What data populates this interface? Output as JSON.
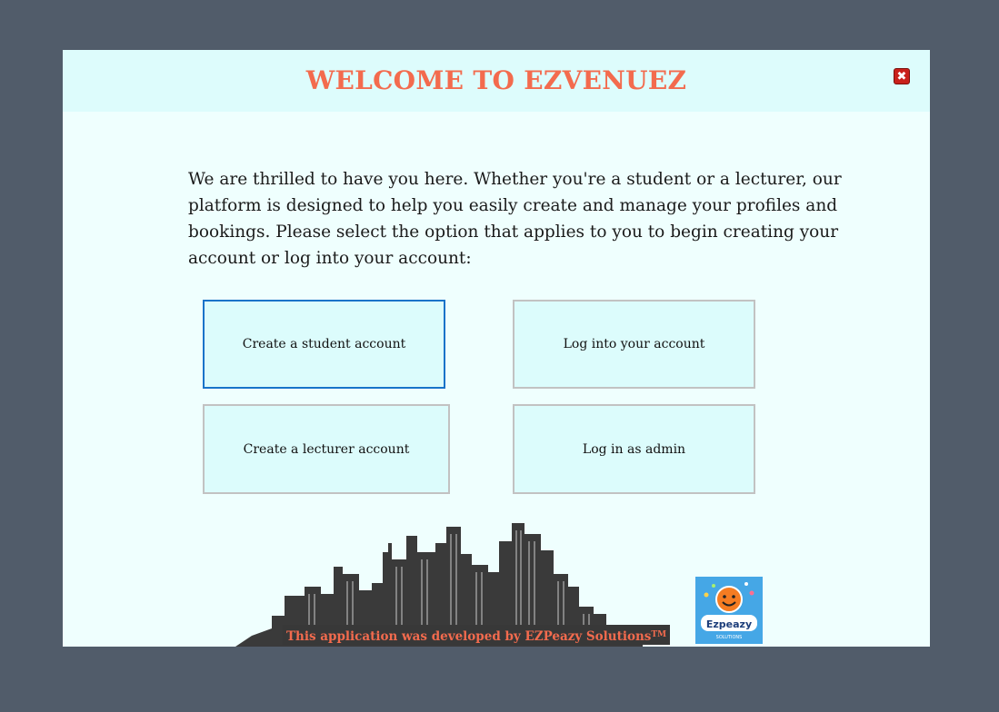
{
  "dialog": {
    "title": "WELCOME TO EZVENUEZ",
    "close_icon": "✖",
    "intro": "We are thrilled to have you here. Whether you're a student or a lecturer, our platform is designed to help you easily create and manage your profiles and bookings. Please select the option that applies to you to begin creating your account or log into your account:"
  },
  "buttons": {
    "create_student": "Create a student account",
    "login": "Log into your account",
    "create_lecturer": "Create a lecturer account",
    "admin_login": "Log in as admin"
  },
  "footer": {
    "credit": "This application was developed by EZPeazy Solutions",
    "trademark": "TM",
    "logo_text": "Ezpeazy",
    "logo_subtext": "SOLUTIONS"
  },
  "colors": {
    "background": "#515c6a",
    "dialog": "#effffe",
    "titlebar": "#ddfcfc",
    "accent": "#f36b4e",
    "button": "#dcfcfc",
    "focus": "#1a73c9"
  },
  "icons": {
    "close": "close-icon",
    "skyline": "city-skyline-icon",
    "logo": "ezpeazy-logo-icon"
  }
}
